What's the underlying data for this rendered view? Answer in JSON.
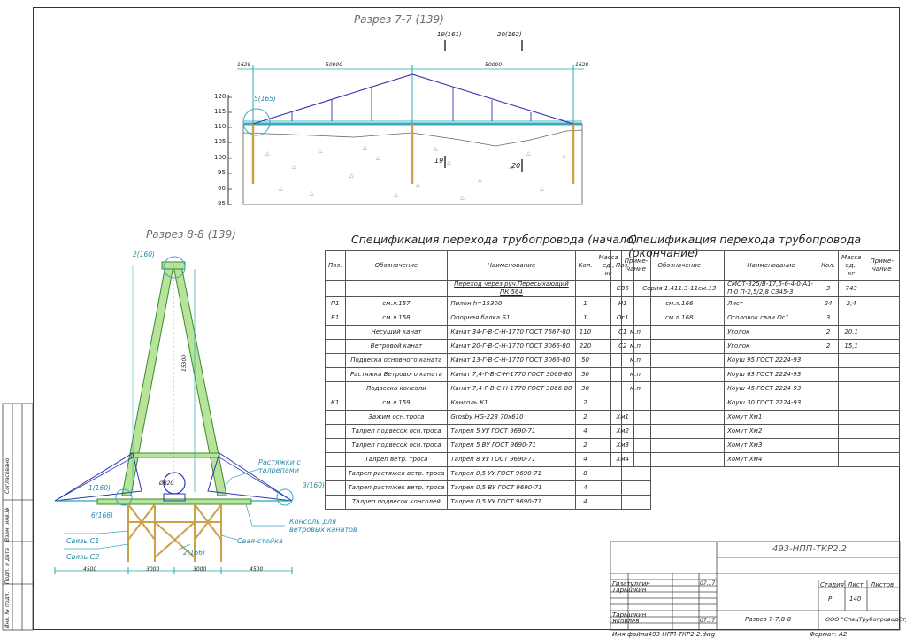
{
  "section77": {
    "title": "Разрез 7-7 (139)",
    "cut_left": "19(161)",
    "cut_right": "20(162)",
    "dim_left": "1628",
    "dim_mid1": "50000",
    "dim_mid2": "50000",
    "dim_right": "1628",
    "callout": "5(165)",
    "mark19": "19",
    "mark20": "20",
    "elevations": [
      "120",
      "115",
      "110",
      "105",
      "100",
      "95",
      "90",
      "85"
    ]
  },
  "section88": {
    "title": "Разрез 8-8 (139)",
    "callouts": [
      "2(160)",
      "1(160)",
      "3(160)",
      "6(166)",
      "2(166)"
    ],
    "dim_height": "15300",
    "dim_bottom": [
      "4500",
      "3000",
      "3000",
      "4500"
    ],
    "labels": {
      "rastyazhki": "Растяжки с талрепами",
      "konsol": "Консоль для ветровых канатов",
      "svyaz_c1": "Связь С1",
      "svyaz_c2": "Связь С2",
      "svaya": "Свая-стойка",
      "pipe": "Ø820"
    }
  },
  "spec1": {
    "title": "Спецификация перехода трубопровода (начало)",
    "headers": [
      "Поз.",
      "Обозначение",
      "Наименование",
      "Кол.",
      "Масса ед., кг",
      "Приме- чание"
    ],
    "rows": [
      [
        "",
        "",
        "Переход через руч.Пересыхающий ПК 564",
        "",
        "",
        ""
      ],
      [
        "П1",
        "см.л.157",
        "Пилон h=15300",
        "1",
        "",
        ""
      ],
      [
        "Б1",
        "см.л.158",
        "Опорная балка Б1",
        "1",
        "",
        ""
      ],
      [
        "",
        "Несущий канат",
        "Канат 34-Г-В-С-Н-1770 ГОСТ 7667-80",
        "110",
        "",
        "м.п."
      ],
      [
        "",
        "Ветровой канат",
        "Канат 20-Г-В-С-Н-1770 ГОСТ 3066-80",
        "220",
        "",
        "м.п."
      ],
      [
        "",
        "Подвеска основного каната",
        "Канат 13-Г-В-С-Н-1770 ГОСТ 3066-80",
        "50",
        "",
        "м.п."
      ],
      [
        "",
        "Растяжка Ветрового каната",
        "Канат 7,4-Г-В-С-Н-1770 ГОСТ 3066-80",
        "50",
        "",
        "м.п."
      ],
      [
        "",
        "Подвеска консоли",
        "Канат 7,4-Г-В-С-Н-1770 ГОСТ 3066-80",
        "30",
        "",
        "м.п."
      ],
      [
        "К1",
        "см.л.159",
        "Консоль К1",
        "2",
        "",
        ""
      ],
      [
        "",
        "Зажим осн.троса",
        "Grosby HG-228 70х610",
        "2",
        "",
        ""
      ],
      [
        "",
        "Талреп подвесок осн.троса",
        "Талреп 5 УУ ГОСТ 9690-71",
        "4",
        "",
        ""
      ],
      [
        "",
        "Талреп подвесок осн.троса",
        "Талреп 5 ВУ ГОСТ 9690-71",
        "2",
        "",
        ""
      ],
      [
        "",
        "Талреп ветр. троса",
        "Талреп 8 УУ ГОСТ 9690-71",
        "4",
        "",
        ""
      ],
      [
        "",
        "Талреп растяжек ветр. троса",
        "Талреп 0,5 УУ ГОСТ 9690-71",
        "8",
        "",
        ""
      ],
      [
        "",
        "Талреп растяжек ветр. троса",
        "Талреп 0,5 ВУ ГОСТ 9690-71",
        "4",
        "",
        ""
      ],
      [
        "",
        "Талреп подвесок консолей",
        "Талреп 0,5 УУ ГОСТ 9690-71",
        "4",
        "",
        ""
      ]
    ]
  },
  "spec2": {
    "title": "Спецификация перехода трубопровода (окончание)",
    "headers": [
      "Поз.",
      "Обозначение",
      "Наименование",
      "Кол.",
      "Масса ед., кг",
      "Приме- чание"
    ],
    "rows": [
      [
        "СВ6",
        "Серия 1.411.3-11см.13",
        "СМОТ-325/В-17,5-6-4-0-А1-П-0 П-2,5/2,8 С345-3",
        "3",
        "743",
        ""
      ],
      [
        "Н1",
        "см.л.166",
        "Лист",
        "24",
        "2,4",
        ""
      ],
      [
        "Ог1",
        "см.л.168",
        "Оголовок сваи Ог1",
        "3",
        "",
        ""
      ],
      [
        "С1",
        "",
        "Уголок",
        "2",
        "20,1",
        ""
      ],
      [
        "С2",
        "",
        "Уголок",
        "2",
        "15,1",
        ""
      ],
      [
        "",
        "",
        "Коуш 95 ГОСТ 2224-93",
        "",
        "",
        ""
      ],
      [
        "",
        "",
        "Коуш 63 ГОСТ 2224-93",
        "",
        "",
        ""
      ],
      [
        "",
        "",
        "Коуш 45 ГОСТ 2224-93",
        "",
        "",
        ""
      ],
      [
        "",
        "",
        "Коуш 30 ГОСТ 2224-93",
        "",
        "",
        ""
      ],
      [
        "Хм1",
        "",
        "Хомут Хм1",
        "",
        "",
        ""
      ],
      [
        "Хм2",
        "",
        "Хомут Хм2",
        "",
        "",
        ""
      ],
      [
        "Хм3",
        "",
        "Хомут Хм3",
        "",
        "",
        ""
      ],
      [
        "Хм4",
        "",
        "Хомут Хм4",
        "",
        "",
        ""
      ]
    ]
  },
  "titleblock": {
    "code": "493-НПП-ТКР2.2",
    "sheet_name": "Разрез 7-7,8-8",
    "company": "ООО \"СпецТрубопроводСтрой\"",
    "stage_label": "Стадия",
    "sheet_label": "Лист",
    "sheets_label": "Листов",
    "stage": "Р",
    "sheet": "140",
    "people": [
      "Гизатуллин",
      "Тарышкин",
      "Тарышкин",
      "Яковлев"
    ],
    "date": "07.17"
  },
  "footer": {
    "file": "Имя файла493-НПП-ТКР2.2.dwg",
    "format": "Формат: А2"
  },
  "side": {
    "inv": "Инв. № подл.",
    "sign": "Подп. и дата",
    "vzam": "Взам. инв.№",
    "sogl": "Согласовано"
  }
}
